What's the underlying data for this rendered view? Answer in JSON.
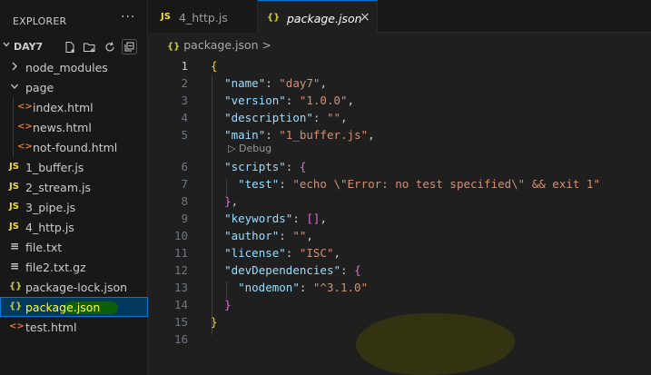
{
  "sidebar": {
    "title": "EXPLORER",
    "more": "···",
    "folder": "DAY7",
    "items": [
      {
        "label": "node_modules",
        "type": "folder",
        "icon": "chevron-right-icon",
        "glyph": ">"
      },
      {
        "label": "page",
        "type": "folder",
        "icon": "chevron-down-icon",
        "glyph": "v"
      },
      {
        "label": "index.html",
        "type": "html",
        "glyph": "<>"
      },
      {
        "label": "news.html",
        "type": "html",
        "glyph": "<>"
      },
      {
        "label": "not-found.html",
        "type": "html",
        "glyph": "<>"
      },
      {
        "label": "1_buffer.js",
        "type": "js",
        "glyph": "JS"
      },
      {
        "label": "2_stream.js",
        "type": "js",
        "glyph": "JS"
      },
      {
        "label": "3_pipe.js",
        "type": "js",
        "glyph": "JS"
      },
      {
        "label": "4_http.js",
        "type": "js",
        "glyph": "JS"
      },
      {
        "label": "file.txt",
        "type": "txt",
        "glyph": "≡"
      },
      {
        "label": "file2.txt.gz",
        "type": "txt",
        "glyph": "≡"
      },
      {
        "label": "package-lock.json",
        "type": "json",
        "glyph": "{}"
      },
      {
        "label": "package.json",
        "type": "json",
        "glyph": "{}",
        "selected": true
      },
      {
        "label": "test.html",
        "type": "html",
        "glyph": "<>"
      }
    ]
  },
  "tabs": [
    {
      "label": "4_http.js",
      "glyph": "JS"
    },
    {
      "label": "package.json",
      "glyph": "{}",
      "close": "×"
    }
  ],
  "breadcrumb": {
    "glyph": "{}",
    "label": "package.json",
    "sep": ">"
  },
  "editor": {
    "line_numbers": [
      "1",
      "2",
      "3",
      "4",
      "5",
      "6",
      "7",
      "8",
      "9",
      "10",
      "11",
      "12",
      "13",
      "14",
      "15",
      "16"
    ],
    "codelens": "Debug",
    "codelens_glyph": "▷",
    "lines": {
      "l1": "{",
      "l2k": "\"name\"",
      "l2v": "\"day7\"",
      "l3k": "\"version\"",
      "l3v": "\"1.0.0\"",
      "l4k": "\"description\"",
      "l4v": "\"\"",
      "l5k": "\"main\"",
      "l5v": "\"1_buffer.js\"",
      "l6k": "\"scripts\"",
      "l6b": "{",
      "l7k": "\"test\"",
      "l7v": "\"echo \\\"Error: no test specified\\\" && exit 1\"",
      "l8b": "}",
      "l9k": "\"keywords\"",
      "l9v": "[]",
      "l10k": "\"author\"",
      "l10v": "\"\"",
      "l11k": "\"license\"",
      "l11v": "\"ISC\"",
      "l12k": "\"devDependencies\"",
      "l12b": "{",
      "l13k": "\"nodemon\"",
      "l13v": "\"^3.1.0\"",
      "l14b": "}",
      "l15": "}"
    }
  },
  "colors": {
    "accent": "#0078d4",
    "json_key": "#9cdcfe",
    "json_string": "#ce9178",
    "selected_highlight": "#0d5f0d"
  }
}
